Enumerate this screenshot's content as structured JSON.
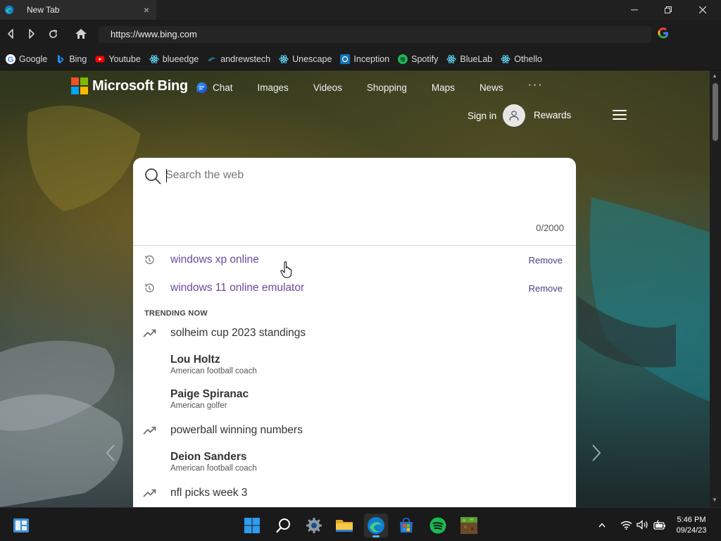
{
  "browser": {
    "tab_title": "New Tab",
    "tab_close": "×",
    "url": "https://www.bing.com",
    "window_controls": [
      "minimize-icon",
      "restore-icon",
      "close-icon"
    ],
    "nav_icons": [
      "back-icon",
      "forward-icon",
      "refresh-icon",
      "home-icon"
    ]
  },
  "bookmarks": [
    {
      "label": "Google",
      "icon": "google-icon",
      "color": "#4285f4"
    },
    {
      "label": "Bing",
      "icon": "bing-icon",
      "color": "#1e90ff"
    },
    {
      "label": "Youtube",
      "icon": "youtube-icon",
      "color": "#ff0000"
    },
    {
      "label": "blueedge",
      "icon": "react-icon",
      "color": "#61dafb"
    },
    {
      "label": "andrewstech",
      "icon": "andrewstech-icon",
      "color": "#2a6f8f"
    },
    {
      "label": "Unescape",
      "icon": "react-icon",
      "color": "#61dafb"
    },
    {
      "label": "Inception",
      "icon": "inception-icon",
      "color": "#1572b6"
    },
    {
      "label": "Spotify",
      "icon": "spotify-icon",
      "color": "#1db954"
    },
    {
      "label": "BlueLab",
      "icon": "react-icon",
      "color": "#61dafb"
    },
    {
      "label": "Othello",
      "icon": "react-icon",
      "color": "#61dafb"
    }
  ],
  "bing": {
    "logo_text": "Microsoft Bing",
    "nav": [
      {
        "label": "Chat",
        "icon": "chat-icon"
      },
      {
        "label": "Images"
      },
      {
        "label": "Videos"
      },
      {
        "label": "Shopping"
      },
      {
        "label": "Maps"
      },
      {
        "label": "News"
      }
    ],
    "more": "···",
    "signin": "Sign in",
    "rewards": "Rewards"
  },
  "search": {
    "placeholder": "Search the web",
    "value": "",
    "char_count": "0/2000",
    "history": [
      {
        "text": "windows xp online",
        "remove": "Remove"
      },
      {
        "text": "windows 11 online emulator",
        "remove": "Remove"
      }
    ],
    "trending_header": "TRENDING NOW",
    "trending": [
      {
        "type": "query",
        "text": "solheim cup 2023 standings"
      },
      {
        "type": "entity",
        "name": "Lou Holtz",
        "desc": "American football coach"
      },
      {
        "type": "entity",
        "name": "Paige Spiranac",
        "desc": "American golfer"
      },
      {
        "type": "query",
        "text": "powerball winning numbers"
      },
      {
        "type": "entity",
        "name": "Deion Sanders",
        "desc": "American football coach"
      },
      {
        "type": "query",
        "text": "nfl picks week 3"
      }
    ]
  },
  "taskbar": {
    "apps": [
      "start-icon",
      "search-icon",
      "settings-icon",
      "file-explorer-icon",
      "edge-icon",
      "store-icon",
      "spotify-icon",
      "minecraft-icon"
    ],
    "tray": [
      "chevron-up-icon",
      "wifi-icon",
      "volume-icon",
      "battery-icon"
    ],
    "time": "5:46 PM",
    "date": "09/24/23"
  },
  "colors": {
    "history_text": "#6b4a9c",
    "remove_link": "#4a3f86",
    "edge_accent": "#0f7fd4",
    "spotify": "#1db954"
  }
}
